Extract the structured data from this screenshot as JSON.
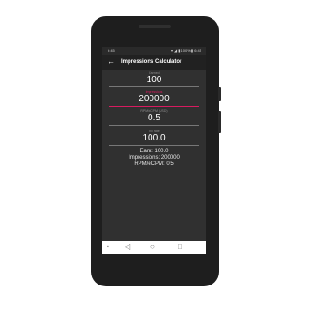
{
  "status_bar": {
    "time": "6:45",
    "icons": "▾ ◢ ▮ 100% ▮ 6:45"
  },
  "app_bar": {
    "back_icon": "←",
    "title": "Impressions Calculator"
  },
  "fields": [
    {
      "label": "Earned",
      "value": "100"
    },
    {
      "label": "Impressions",
      "value": "200000"
    },
    {
      "label": "RPM/eCPM (USD)",
      "value": "0.5"
    },
    {
      "label": "Fill rate",
      "value": "100.0"
    }
  ],
  "results": {
    "earn": "Earn: 100.0",
    "impressions": "Impressions: 200000",
    "rpm": "RPM/eCPM: 0.5"
  },
  "nav_bar": {
    "menu_icon": "▪",
    "back_icon": "◁",
    "home_icon": "○",
    "recents_icon": "□"
  },
  "colors": {
    "accent": "#d81b60",
    "screen_bg": "#303030",
    "appbar_bg": "#212121"
  }
}
